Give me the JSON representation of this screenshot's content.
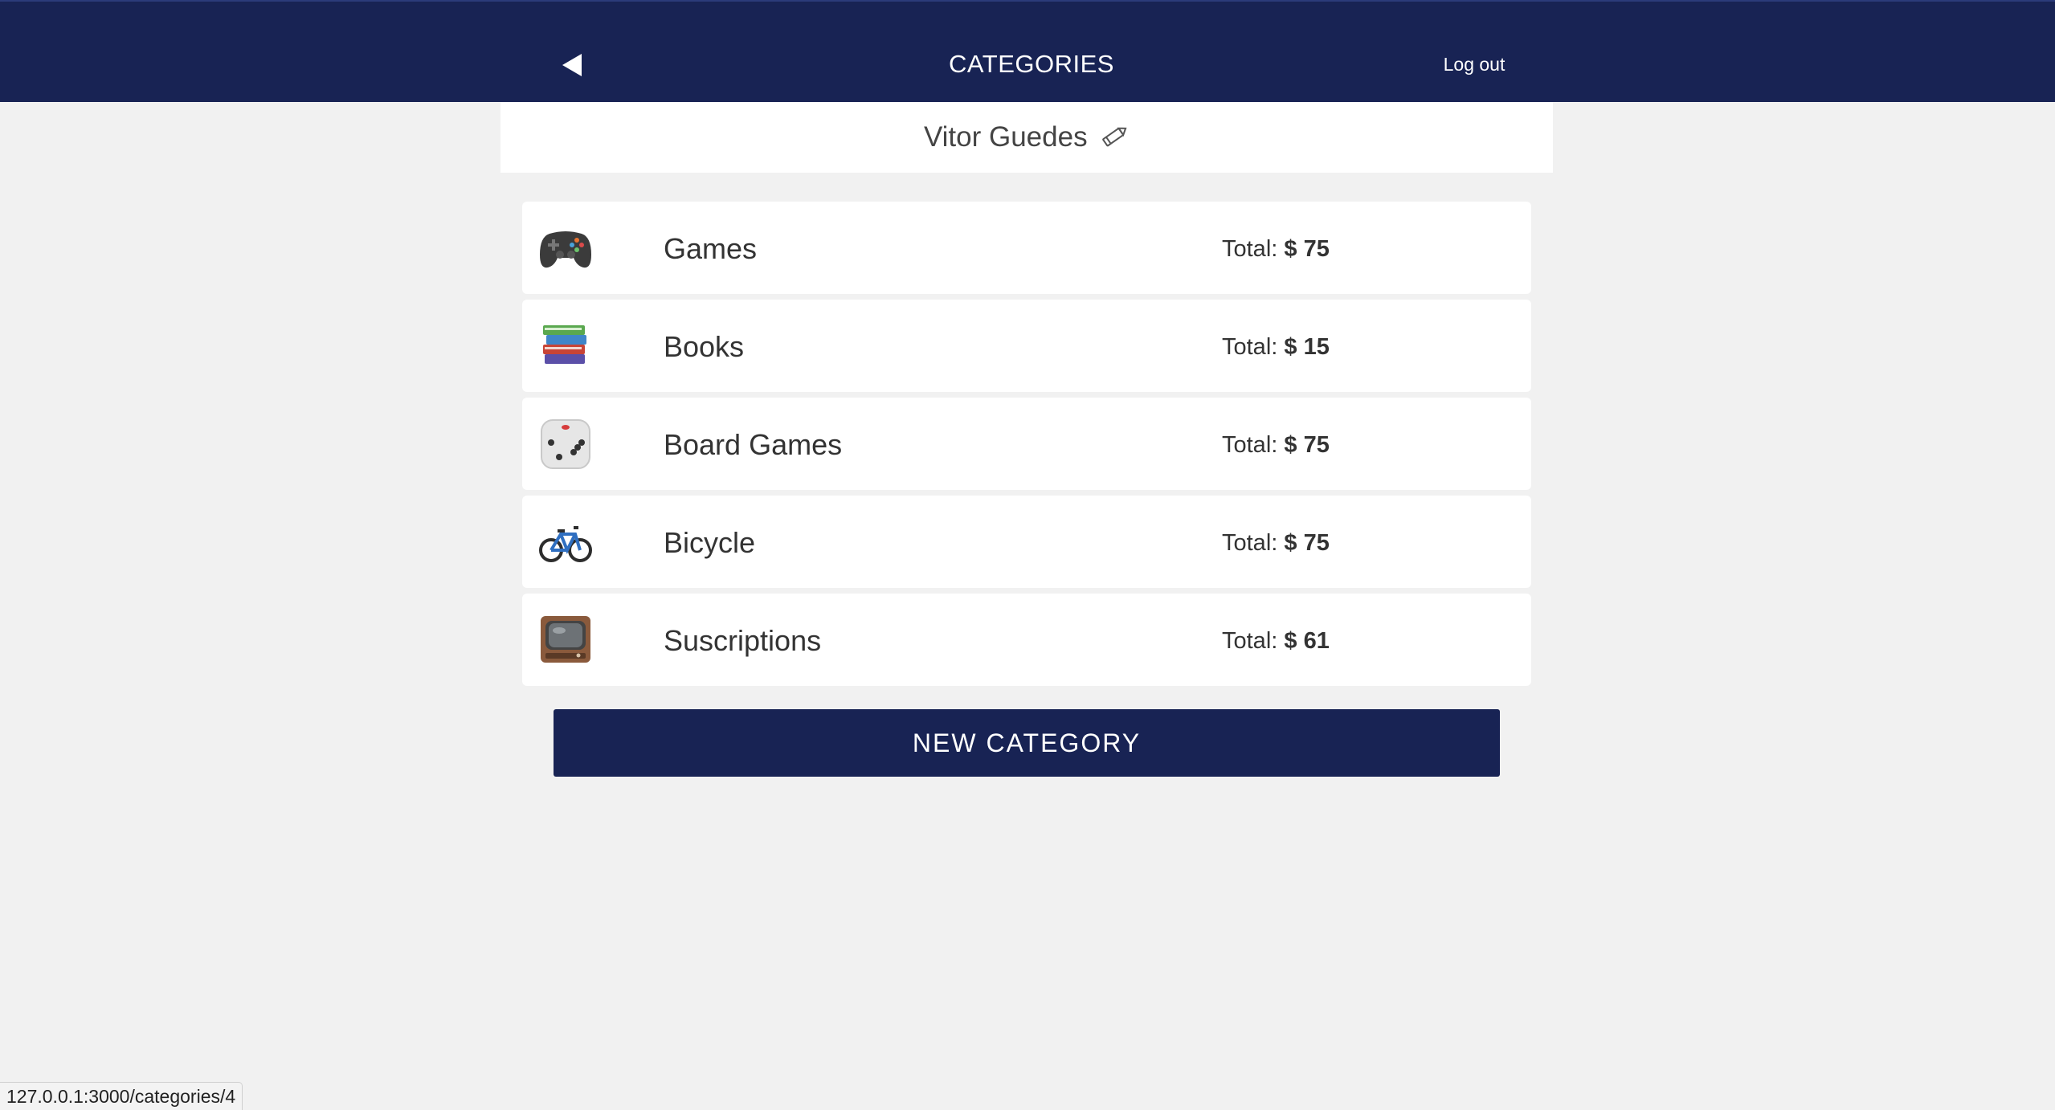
{
  "header": {
    "title": "CATEGORIES",
    "logout_label": "Log out",
    "back_icon": "back-triangle-icon"
  },
  "user": {
    "name": "Vitor Guedes",
    "edit_icon": "pencil-icon"
  },
  "categories": [
    {
      "name": "Games",
      "total_label": "Total:",
      "amount": "$ 75",
      "icon": "game-controller-icon"
    },
    {
      "name": "Books",
      "total_label": "Total:",
      "amount": "$ 15",
      "icon": "books-icon"
    },
    {
      "name": "Board Games",
      "total_label": "Total:",
      "amount": "$ 75",
      "icon": "dice-icon"
    },
    {
      "name": "Bicycle",
      "total_label": "Total:",
      "amount": "$ 75",
      "icon": "bicycle-icon"
    },
    {
      "name": "Suscriptions",
      "total_label": "Total:",
      "amount": "$ 61",
      "icon": "television-icon"
    }
  ],
  "actions": {
    "new_category_label": "NEW CATEGORY"
  },
  "status_bar": {
    "url": "127.0.0.1:3000/categories/4"
  },
  "colors": {
    "navbar": "#182354",
    "background": "#f1f1f1",
    "card": "#ffffff",
    "button": "#182354"
  }
}
